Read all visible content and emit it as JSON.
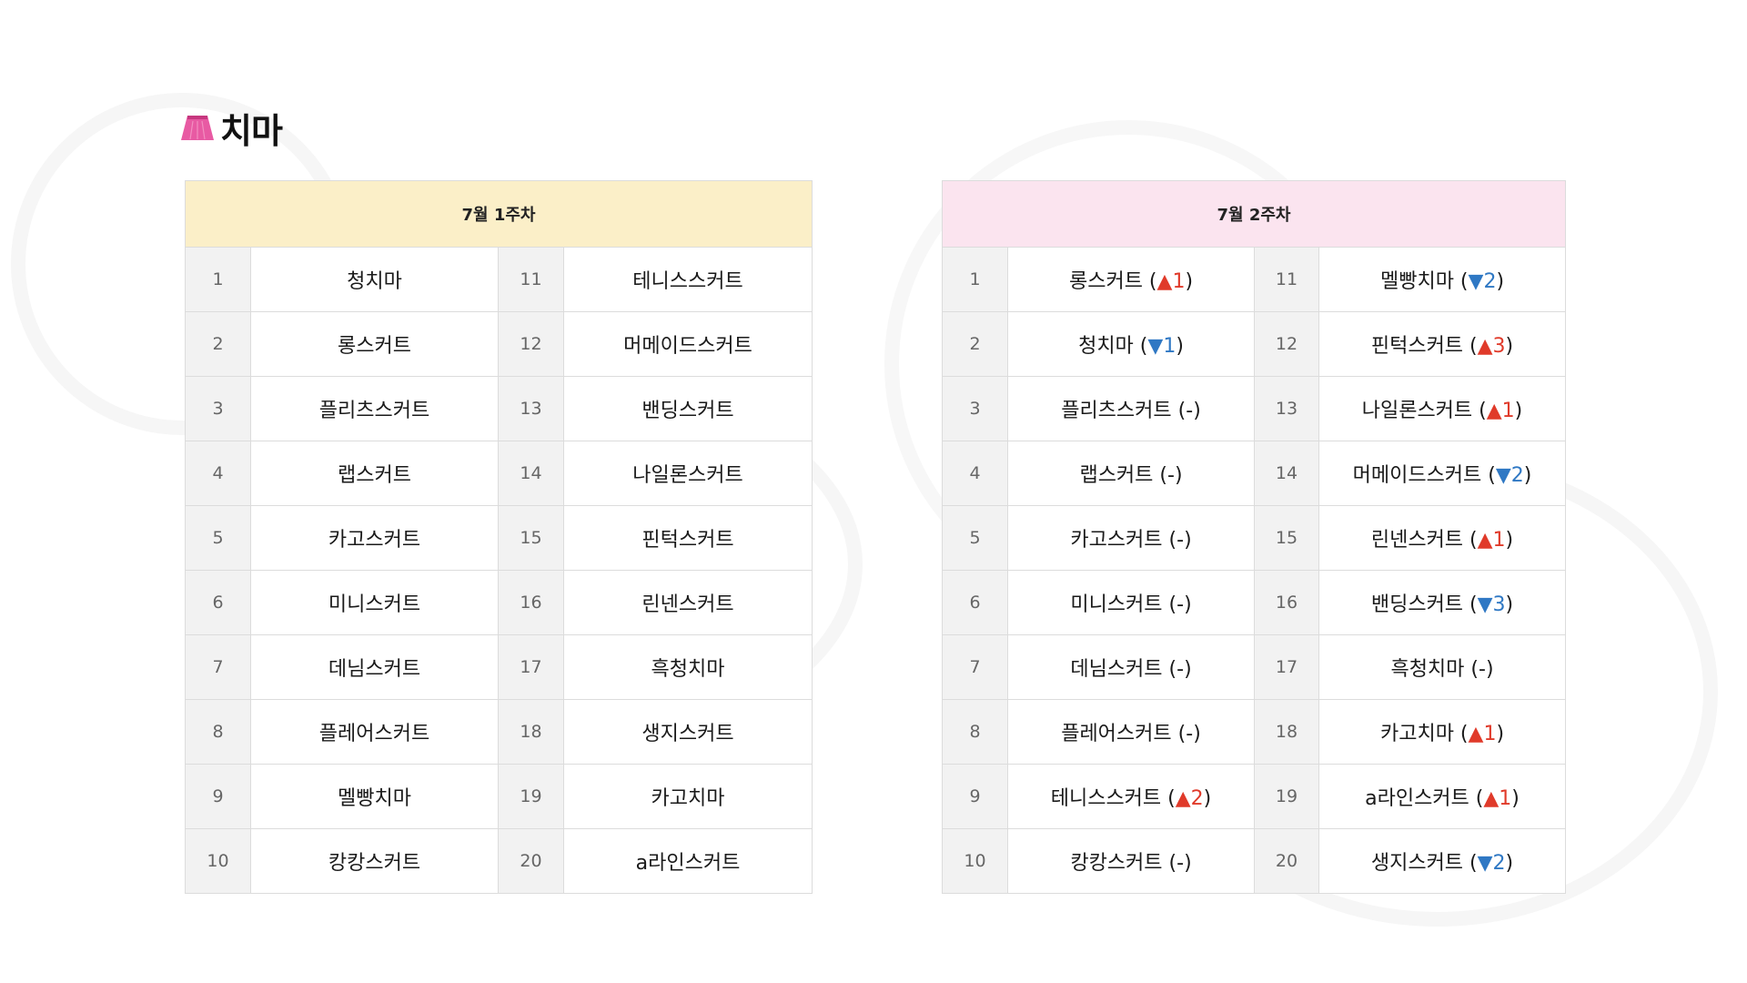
{
  "section": {
    "title": "치마",
    "icon": "skirt-icon",
    "icon_color": "#e85aa3"
  },
  "week1": {
    "header": "7월 1주차",
    "header_bg": "#fbefc8",
    "ranks": [
      {
        "rank": "1",
        "name": "청치마"
      },
      {
        "rank": "2",
        "name": "롱스커트"
      },
      {
        "rank": "3",
        "name": "플리츠스커트"
      },
      {
        "rank": "4",
        "name": "랩스커트"
      },
      {
        "rank": "5",
        "name": "카고스커트"
      },
      {
        "rank": "6",
        "name": "미니스커트"
      },
      {
        "rank": "7",
        "name": "데님스커트"
      },
      {
        "rank": "8",
        "name": "플레어스커트"
      },
      {
        "rank": "9",
        "name": "멜빵치마"
      },
      {
        "rank": "10",
        "name": "캉캉스커트"
      },
      {
        "rank": "11",
        "name": "테니스스커트"
      },
      {
        "rank": "12",
        "name": "머메이드스커트"
      },
      {
        "rank": "13",
        "name": "밴딩스커트"
      },
      {
        "rank": "14",
        "name": "나일론스커트"
      },
      {
        "rank": "15",
        "name": "핀턱스커트"
      },
      {
        "rank": "16",
        "name": "린넨스커트"
      },
      {
        "rank": "17",
        "name": "흑청치마"
      },
      {
        "rank": "18",
        "name": "생지스커트"
      },
      {
        "rank": "19",
        "name": "카고치마"
      },
      {
        "rank": "20",
        "name": "a라인스커트"
      }
    ]
  },
  "week2": {
    "header": "7월 2주차",
    "header_bg": "#fbe4ef",
    "up_color": "#e03a2a",
    "down_color": "#2f78c4",
    "ranks": [
      {
        "rank": "1",
        "name": "롱스커트",
        "change": "up",
        "amount": "1"
      },
      {
        "rank": "2",
        "name": "청치마",
        "change": "down",
        "amount": "1"
      },
      {
        "rank": "3",
        "name": "플리츠스커트",
        "change": "same",
        "amount": "-"
      },
      {
        "rank": "4",
        "name": "랩스커트",
        "change": "same",
        "amount": "-"
      },
      {
        "rank": "5",
        "name": "카고스커트",
        "change": "same",
        "amount": "-"
      },
      {
        "rank": "6",
        "name": "미니스커트",
        "change": "same",
        "amount": "-"
      },
      {
        "rank": "7",
        "name": "데님스커트",
        "change": "same",
        "amount": "-"
      },
      {
        "rank": "8",
        "name": "플레어스커트",
        "change": "same",
        "amount": "-"
      },
      {
        "rank": "9",
        "name": "테니스스커트",
        "change": "up",
        "amount": "2"
      },
      {
        "rank": "10",
        "name": "캉캉스커트",
        "change": "same",
        "amount": "-"
      },
      {
        "rank": "11",
        "name": "멜빵치마",
        "change": "down",
        "amount": "2"
      },
      {
        "rank": "12",
        "name": "핀턱스커트",
        "change": "up",
        "amount": "3"
      },
      {
        "rank": "13",
        "name": "나일론스커트",
        "change": "up",
        "amount": "1"
      },
      {
        "rank": "14",
        "name": "머메이드스커트",
        "change": "down",
        "amount": "2"
      },
      {
        "rank": "15",
        "name": "린넨스커트",
        "change": "up",
        "amount": "1"
      },
      {
        "rank": "16",
        "name": "밴딩스커트",
        "change": "down",
        "amount": "3"
      },
      {
        "rank": "17",
        "name": "흑청치마",
        "change": "same",
        "amount": "-"
      },
      {
        "rank": "18",
        "name": "카고치마",
        "change": "up",
        "amount": "1"
      },
      {
        "rank": "19",
        "name": "a라인스커트",
        "change": "up",
        "amount": "1"
      },
      {
        "rank": "20",
        "name": "생지스커트",
        "change": "down",
        "amount": "2"
      }
    ]
  }
}
